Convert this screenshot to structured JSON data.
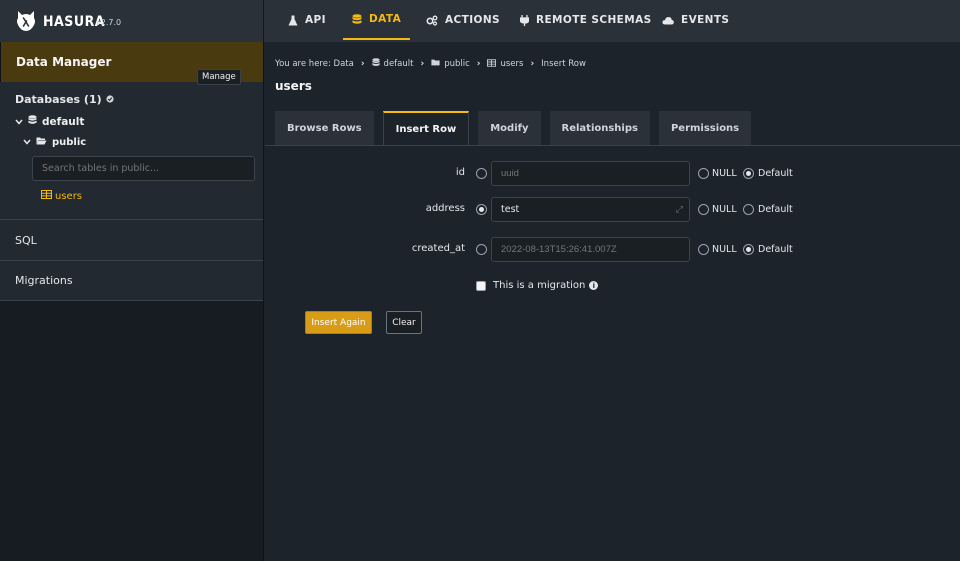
{
  "brand": {
    "name": "HASURA",
    "version": "v2.7.0"
  },
  "nav": [
    {
      "label": "API",
      "icon": "flask-icon"
    },
    {
      "label": "DATA",
      "icon": "database-icon",
      "active": true
    },
    {
      "label": "ACTIONS",
      "icon": "cogs-icon"
    },
    {
      "label": "REMOTE SCHEMAS",
      "icon": "plug-icon"
    },
    {
      "label": "EVENTS",
      "icon": "cloud-icon"
    }
  ],
  "sidebar": {
    "header": "Data Manager",
    "databases_title": "Databases (1)",
    "manage_label": "Manage",
    "database": "default",
    "schema": "public",
    "search_placeholder": "Search tables in public...",
    "table": "users",
    "sections": [
      "SQL",
      "Migrations"
    ]
  },
  "breadcrumb": {
    "prefix": "You are here: Data",
    "items": [
      "default",
      "public",
      "users",
      "Insert Row"
    ]
  },
  "page_title": "users",
  "tabs": [
    "Browse Rows",
    "Insert Row",
    "Modify",
    "Relationships",
    "Permissions"
  ],
  "active_tab": "Insert Row",
  "fields": [
    {
      "name": "id",
      "placeholder": "uuid",
      "value": "",
      "selected": "default"
    },
    {
      "name": "address",
      "placeholder": "",
      "value": "test",
      "selected": "value"
    },
    {
      "name": "created_at",
      "placeholder": "2022-08-13T15:26:41.007Z",
      "value": "",
      "selected": "default"
    }
  ],
  "null_label": "NULL",
  "default_label": "Default",
  "migration_label": "This is a migration",
  "insert_again_label": "Insert Again",
  "clear_label": "Clear",
  "colors": {
    "accent": "#f3ba12",
    "sidebar_header": "#4a3a10",
    "button": "#d89c16"
  }
}
